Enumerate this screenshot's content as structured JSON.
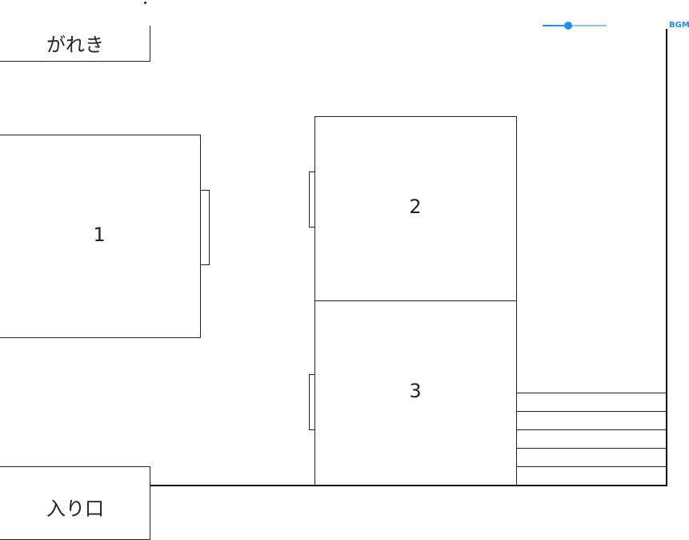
{
  "rooms": {
    "gravel": "がれき",
    "entrance": "入り口",
    "room1": "1",
    "room2": "2",
    "room3": "3"
  },
  "bgm": {
    "label": "BGM",
    "volume": 0.4
  },
  "colors": {
    "accent": "#2b8ae6",
    "wall": "#111111"
  }
}
